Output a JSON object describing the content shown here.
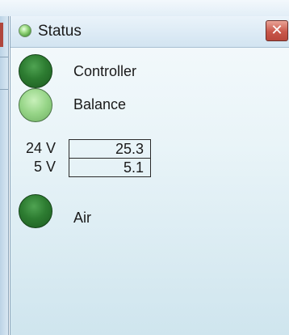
{
  "panel": {
    "title": "Status",
    "close_glyph": "✕"
  },
  "indicators": [
    {
      "label": "Controller",
      "state": "on",
      "color": "#2d7c31"
    },
    {
      "label": "Balance",
      "state": "off",
      "color": "#95d486"
    },
    {
      "label": "Air",
      "state": "on",
      "color": "#2d7c31"
    }
  ],
  "voltages": [
    {
      "label": "24 V",
      "value": "25.3"
    },
    {
      "label": "5 V",
      "value": "5.1"
    }
  ],
  "icons": {
    "title": "status-led-icon",
    "close": "close-icon"
  }
}
